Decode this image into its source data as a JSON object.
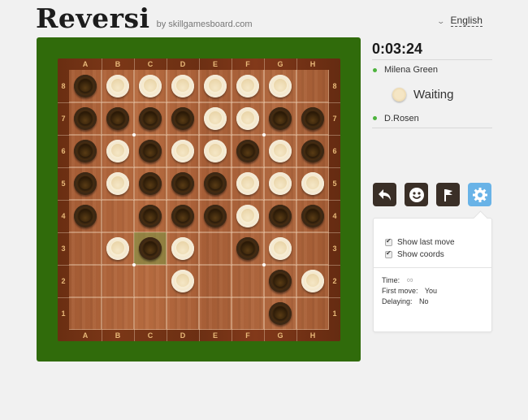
{
  "header": {
    "title": "Reversi",
    "subtitle": "by skillgamesboard.com",
    "language": "English"
  },
  "board": {
    "columns": [
      "A",
      "B",
      "C",
      "D",
      "E",
      "F",
      "G",
      "H"
    ],
    "rows": [
      "8",
      "7",
      "6",
      "5",
      "4",
      "3",
      "2",
      "1"
    ],
    "cells": [
      [
        "b",
        "w",
        "w",
        "w",
        "w",
        "w",
        "w",
        "."
      ],
      [
        "b",
        "b",
        "b",
        "b",
        "w",
        "w",
        "b",
        "b"
      ],
      [
        "b",
        "w",
        "b",
        "w",
        "w",
        "b",
        "w",
        "b"
      ],
      [
        "b",
        "w",
        "b",
        "b",
        "b",
        "w",
        "w",
        "w"
      ],
      [
        "b",
        ".",
        "b",
        "b",
        "b",
        "w",
        "b",
        "b"
      ],
      [
        ".",
        "w",
        "b",
        "w",
        ".",
        "b",
        "w",
        "."
      ],
      [
        ".",
        ".",
        ".",
        "w",
        ".",
        ".",
        "b",
        "w"
      ],
      [
        ".",
        ".",
        ".",
        ".",
        ".",
        ".",
        "b",
        "."
      ]
    ],
    "last_move": "C3"
  },
  "game": {
    "timer": "0:03:24",
    "player_top": "Milena Green",
    "player_bottom": "D.Rosen",
    "status": "Waiting",
    "online_color": "#4db33d"
  },
  "toolbar": {
    "buttons": [
      {
        "name": "undo",
        "icon": "undo-arrow-icon"
      },
      {
        "name": "emoji",
        "icon": "smiley-icon"
      },
      {
        "name": "resign",
        "icon": "flag-icon"
      },
      {
        "name": "settings",
        "icon": "gear-icon",
        "active": true
      }
    ],
    "active_color": "#69b3e7"
  },
  "settings": {
    "show_last_move": {
      "label": "Show last move",
      "checked": true
    },
    "show_coords": {
      "label": "Show coords",
      "checked": true
    },
    "time_label": "Time:",
    "time_value": "∞",
    "first_move_label": "First move:",
    "first_move_value": "You",
    "delaying_label": "Delaying:",
    "delaying_value": "No"
  }
}
